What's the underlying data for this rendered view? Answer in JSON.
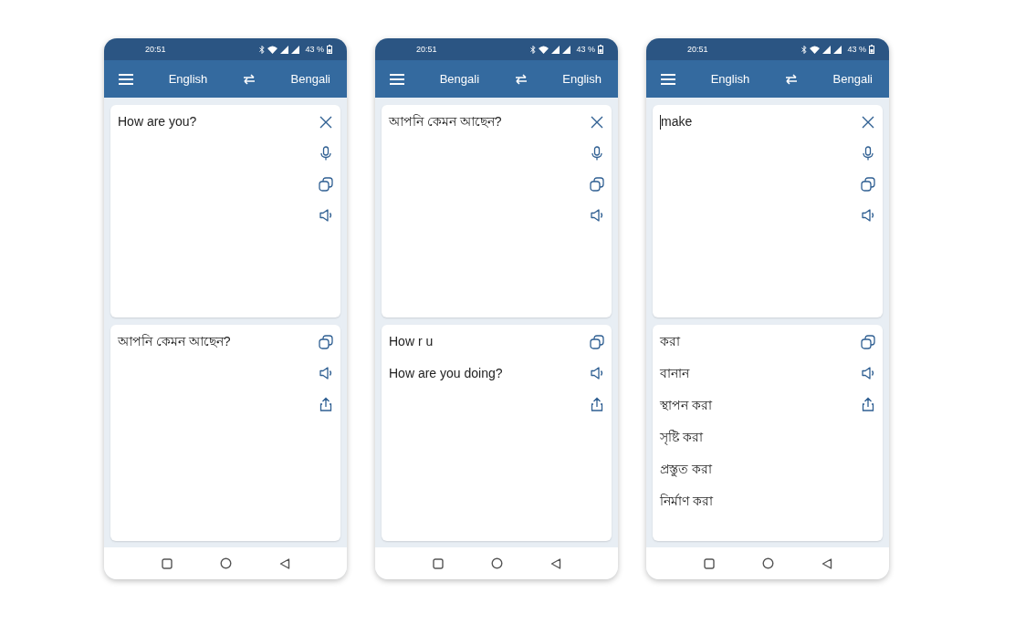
{
  "phones": [
    {
      "status_bar": {
        "time": "20:51",
        "battery": "43 %"
      },
      "app_bar": {
        "source_language": "English",
        "target_language": "Bengali"
      },
      "input": {
        "text": "How are you?",
        "cursor": false
      },
      "output": {
        "lines": [
          "আপনি কেমন আছেন?"
        ]
      }
    },
    {
      "status_bar": {
        "time": "20:51",
        "battery": "43 %"
      },
      "app_bar": {
        "source_language": "Bengali",
        "target_language": "English"
      },
      "input": {
        "text": "আপনি কেমন আছেন?",
        "cursor": false
      },
      "output": {
        "lines": [
          "How r u",
          "How are you doing?"
        ]
      }
    },
    {
      "status_bar": {
        "time": "20:51",
        "battery": "43 %"
      },
      "app_bar": {
        "source_language": "English",
        "target_language": "Bengali"
      },
      "input": {
        "text": "make",
        "cursor": true
      },
      "output": {
        "lines": [
          "করা",
          "বানান",
          "স্থাপন করা",
          "সৃষ্টি করা",
          "প্রস্তুত করা",
          "নির্মাণ করা"
        ]
      }
    }
  ]
}
